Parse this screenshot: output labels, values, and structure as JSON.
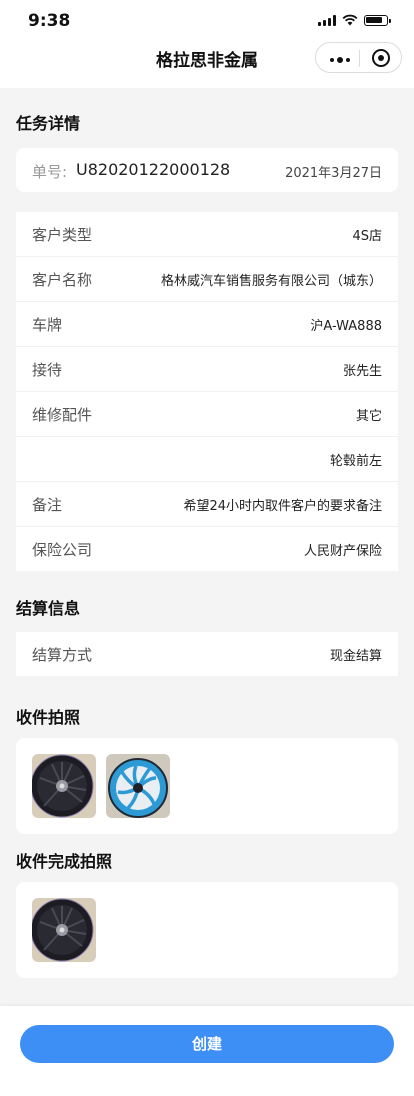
{
  "status_bar": {
    "time": "9:38"
  },
  "nav": {
    "title": "格拉思非金属"
  },
  "task": {
    "section_title": "任务详情",
    "order_label": "单号:",
    "order_no": "U82020122000128",
    "order_date": "2021年3月27日",
    "fields": [
      {
        "label": "客户类型",
        "value": "4S店"
      },
      {
        "label": "客户名称",
        "value": "格林威汽车销售服务有限公司（城东）"
      },
      {
        "label": "车牌",
        "value": "沪A-WA888"
      },
      {
        "label": "接待",
        "value": "张先生"
      },
      {
        "label": "维修配件",
        "value": "其它"
      },
      {
        "label": "",
        "value": "轮毂前左"
      },
      {
        "label": "备注",
        "value": "希望24小时内取件客户的要求备注"
      },
      {
        "label": "保险公司",
        "value": "人民财产保险"
      }
    ]
  },
  "settlement": {
    "section_title": "结算信息",
    "label": "结算方式",
    "value": "现金结算"
  },
  "receive_photos": {
    "section_title": "收件拍照",
    "photos": [
      "black-rim-wheel-photo",
      "blue-rim-wheel-photo"
    ]
  },
  "complete_photos": {
    "section_title": "收件完成拍照",
    "photos": [
      "black-rim-wheel-photo"
    ]
  },
  "footer": {
    "create_label": "创建"
  },
  "colors": {
    "primary": "#3d8ff5",
    "page_bg": "#f4f4f4",
    "wheel_blue": "#2d9ad6"
  }
}
